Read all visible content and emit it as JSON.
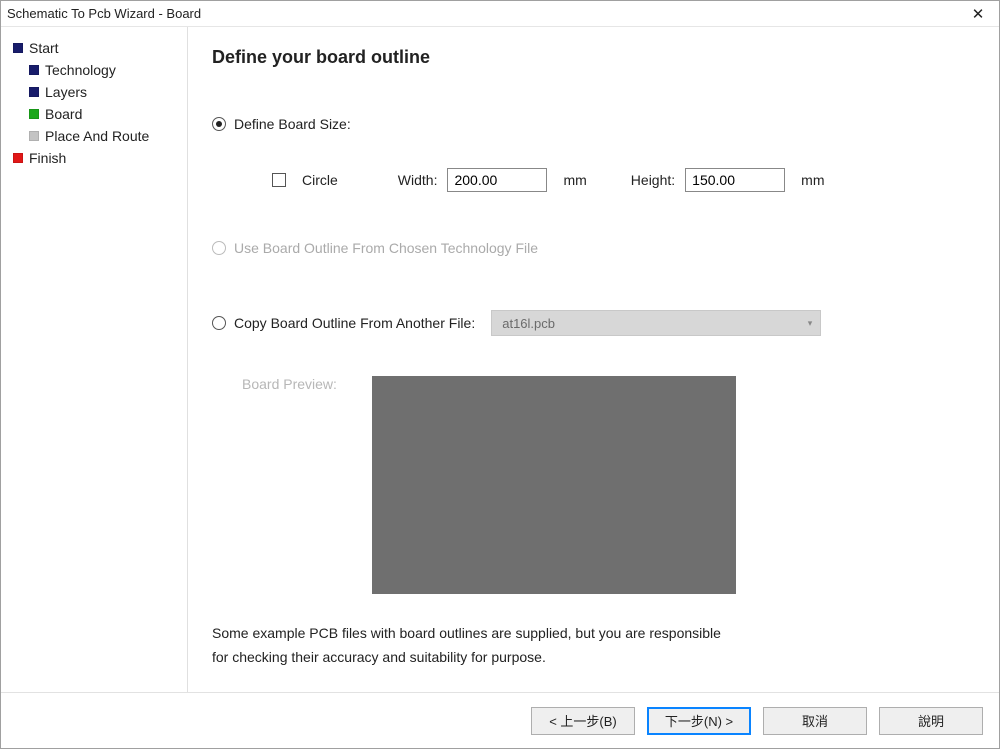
{
  "window": {
    "title": "Schematic To Pcb Wizard - Board"
  },
  "sidebar": {
    "items": [
      {
        "label": "Start",
        "square": "navy",
        "level": 1
      },
      {
        "label": "Technology",
        "square": "navy",
        "level": 2
      },
      {
        "label": "Layers",
        "square": "navy",
        "level": 2
      },
      {
        "label": "Board",
        "square": "green",
        "level": 2
      },
      {
        "label": "Place And Route",
        "square": "gray",
        "level": 2
      },
      {
        "label": "Finish",
        "square": "red",
        "level": 1
      }
    ]
  },
  "main": {
    "heading": "Define your board outline",
    "opt_define_size": "Define Board Size:",
    "circle_label": "Circle",
    "width_label": "Width:",
    "width_value": "200.00",
    "width_unit": "mm",
    "height_label": "Height:",
    "height_value": "150.00",
    "height_unit": "mm",
    "opt_use_tech": "Use Board Outline From Chosen Technology File",
    "opt_copy_file": "Copy Board Outline From Another File:",
    "copy_file_value": "at16l.pcb",
    "preview_label": "Board Preview:",
    "hint": "Some example PCB files with board outlines are supplied, but you are responsible for checking their accuracy and suitability for purpose."
  },
  "footer": {
    "back": "< 上一步(B)",
    "next": "下一步(N) >",
    "cancel": "取消",
    "help": "說明"
  }
}
